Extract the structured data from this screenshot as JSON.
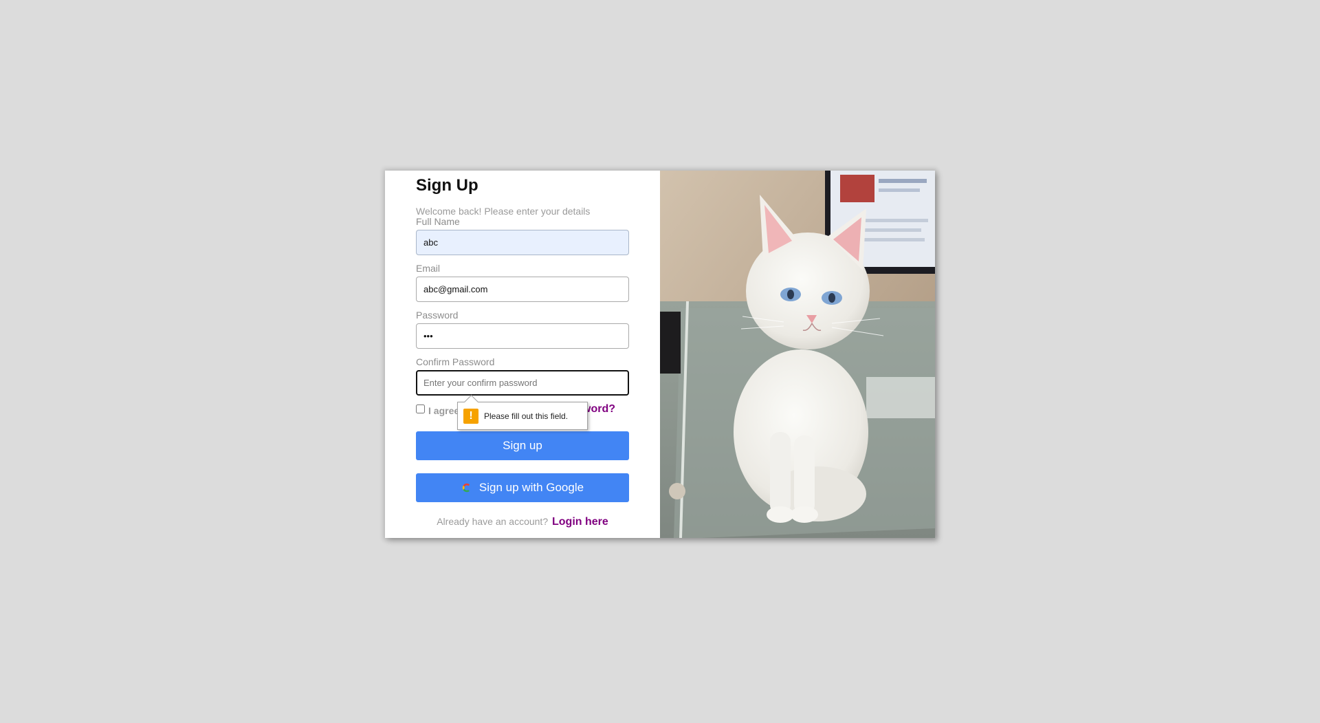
{
  "form": {
    "title": "Sign Up",
    "subtitle": "Welcome back! Please enter your details",
    "full_name": {
      "label": "Full Name",
      "value": "abc"
    },
    "email": {
      "label": "Email",
      "value": "abc@gmail.com"
    },
    "password": {
      "label": "Password",
      "value": "•••"
    },
    "confirm_password": {
      "label": "Confirm Password",
      "placeholder": "Enter your confirm password"
    },
    "agree_label": "I agree",
    "forgot_link": "Forgot password?",
    "signup_button": "Sign up",
    "google_button": "Sign up with Google",
    "login_prompt": "Already have an account?",
    "login_link": "Login here"
  },
  "validation_tooltip": {
    "icon": "warning-icon",
    "message": "Please fill out this field."
  },
  "colors": {
    "background": "#dcdcdc",
    "primary_button": "#4285f4",
    "link": "#800080",
    "tooltip_warning": "#f6a200"
  }
}
